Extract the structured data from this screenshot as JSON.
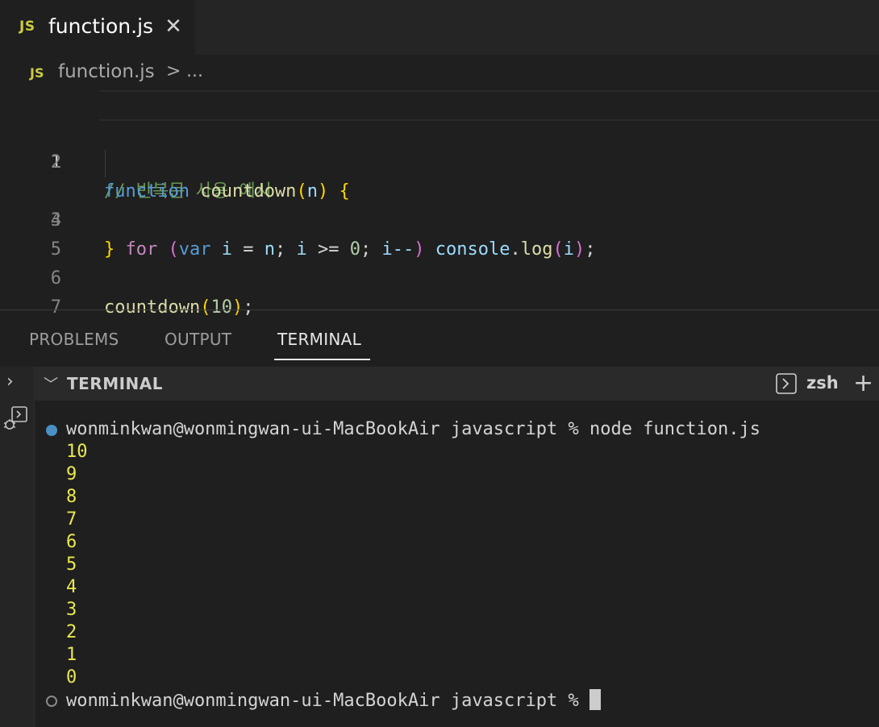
{
  "tab": {
    "icon": "JS",
    "filename": "function.js",
    "close_icon": "close-icon"
  },
  "breadcrumb": {
    "icon": "JS",
    "file": "function.js",
    "separator": ">",
    "more": "..."
  },
  "editor": {
    "line_numbers": [
      "1",
      "2",
      "3",
      "4",
      "5",
      "6",
      "7"
    ],
    "lines": {
      "l1": {
        "comment": "// 반복문 사용 예시"
      },
      "l2": {
        "kw": "function",
        "name": "countdown",
        "open": "(",
        "param": "n",
        "close": ")",
        "brace": "{"
      },
      "l3": {
        "kw": "for",
        "open": "(",
        "var": "var",
        "i1": "i",
        "eq": "=",
        "n": "n",
        "semi1": ";",
        "i2": "i",
        "ge": ">=",
        "zero": "0",
        "semi2": ";",
        "i3": "i--",
        "close": ")",
        "console": "console",
        "dot": ".",
        "log": "log",
        "popen": "(",
        "i4": "i",
        "pclose": ")",
        "semi3": ";"
      },
      "l4": {
        "brace": "}"
      },
      "l6": {
        "name": "countdown",
        "open": "(",
        "arg": "10",
        "close": ")",
        "semi": ";"
      }
    }
  },
  "panel": {
    "tabs": [
      "PROBLEMS",
      "OUTPUT",
      "TERMINAL"
    ],
    "active_tab": "TERMINAL",
    "section_title": "TERMINAL",
    "shell": "zsh"
  },
  "terminal": {
    "command_prompt": "wonminkwan@wonmingwan-ui-MacBookAir javascript % node function.js",
    "output": [
      "10",
      "9",
      "8",
      "7",
      "6",
      "5",
      "4",
      "3",
      "2",
      "1",
      "0"
    ],
    "idle_prompt": "wonminkwan@wonmingwan-ui-MacBookAir javascript %"
  },
  "colors": {
    "output_yellow": "#e8e84f",
    "js_badge": "#cbcb41",
    "status_dot": "#4a90c4"
  }
}
